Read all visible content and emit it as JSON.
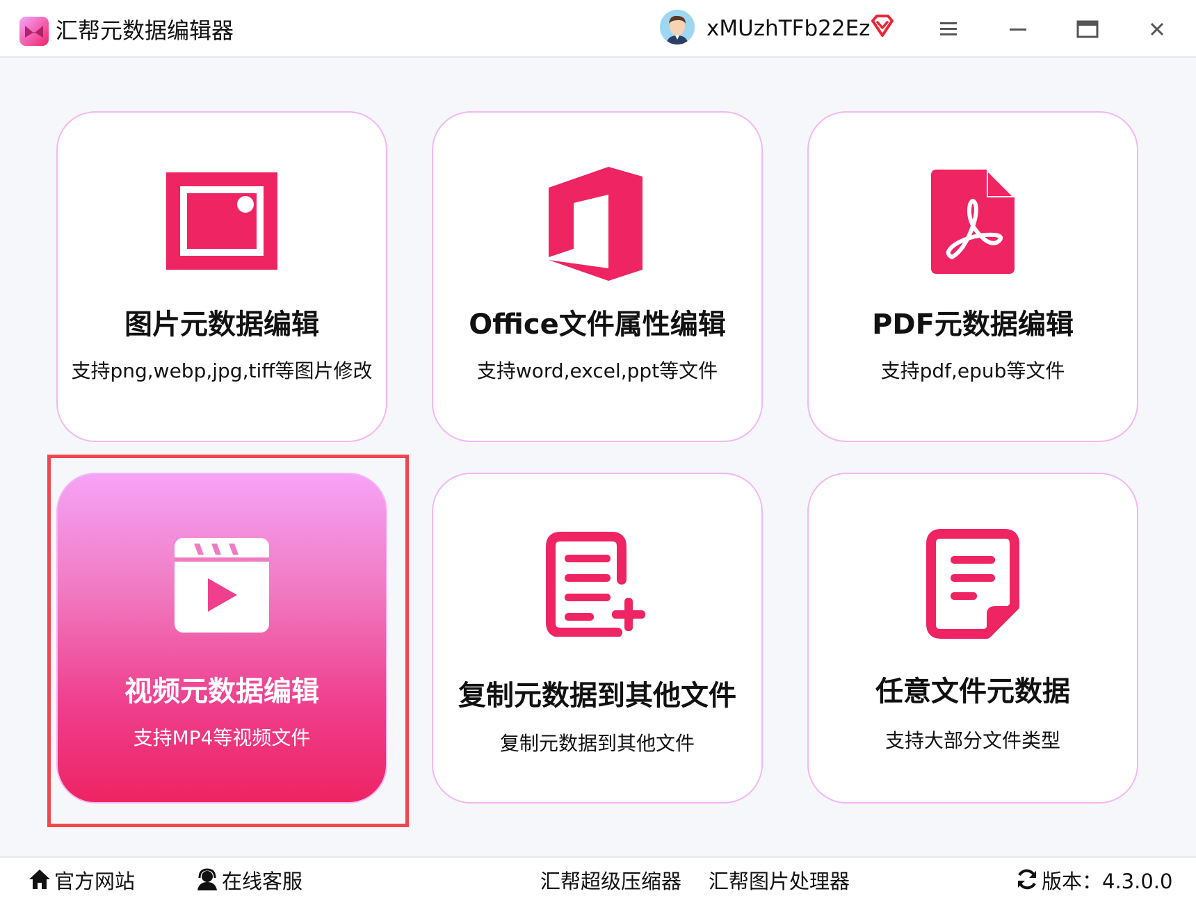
{
  "app": {
    "title": "汇帮元数据编辑器",
    "brand_color": "#ee2463",
    "accent_light": "#f6a3f7"
  },
  "user": {
    "name": "xMUzhTFb22Ez"
  },
  "window_controls": [
    "menu-icon",
    "minimize-icon",
    "maximize-icon",
    "close-icon"
  ],
  "cards": [
    {
      "title": "图片元数据编辑",
      "subtitle": "支持png,webp,jpg,tiff等图片修改",
      "icon": "image-icon",
      "active": false
    },
    {
      "title": "Office文件属性编辑",
      "subtitle": "支持word,excel,ppt等文件",
      "icon": "office-icon",
      "active": false
    },
    {
      "title": "PDF元数据编辑",
      "subtitle": "支持pdf,epub等文件",
      "icon": "pdf-icon",
      "active": false
    },
    {
      "title": "视频元数据编辑",
      "subtitle": "支持MP4等视频文件",
      "icon": "video-icon",
      "active": true
    },
    {
      "title": "复制元数据到其他文件",
      "subtitle": "复制元数据到其他文件",
      "icon": "document-add-icon",
      "active": false
    },
    {
      "title": "任意文件元数据",
      "subtitle": "支持大部分文件类型",
      "icon": "document-icon",
      "active": false
    }
  ],
  "footer": {
    "website": "官方网站",
    "support": "在线客服",
    "compressor": "汇帮超级压缩器",
    "image_tool": "汇帮图片处理器",
    "version_label": "版本：4.3.0.0"
  }
}
